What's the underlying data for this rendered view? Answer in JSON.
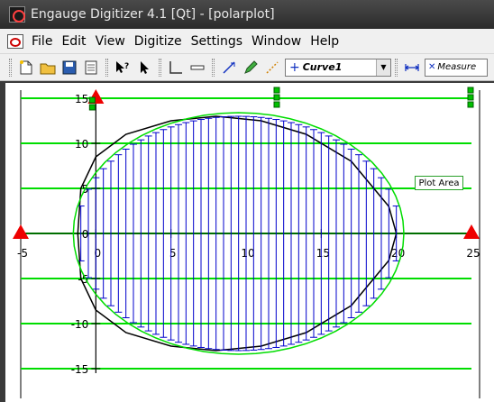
{
  "window": {
    "title": "Engauge Digitizer 4.1 [Qt] - [polarplot]"
  },
  "menu": [
    "File",
    "Edit",
    "View",
    "Digitize",
    "Settings",
    "Window",
    "Help"
  ],
  "toolbar": {
    "curve_name": "Curve1",
    "measure_name": "Measure"
  },
  "plot": {
    "x_ticks": [
      "-5",
      "0",
      "5",
      "10",
      "15",
      "20",
      "25"
    ],
    "y_ticks": [
      "15",
      "10",
      "5",
      "0",
      "-5",
      "-10",
      "-15"
    ],
    "segment_label": "Plot Area",
    "colors": {
      "grid": "#00dd00",
      "curve": "#0000cc",
      "axis_point": "#ee0000",
      "outline": "#000000"
    }
  },
  "chart_data": {
    "type": "line",
    "title": "",
    "xlabel": "",
    "ylabel": "",
    "xlim": [
      -5,
      25
    ],
    "ylim": [
      -15,
      15
    ],
    "grid": true,
    "axis_points": [
      [
        -5,
        0
      ],
      [
        25,
        0
      ],
      [
        0,
        15
      ]
    ],
    "series": [
      {
        "x": [
          -1.2,
          -1.0,
          0.0,
          2.0,
          5.0,
          8.0,
          11.0,
          14.0,
          17.0,
          19.5,
          20.0,
          19.5,
          17.0,
          14.0,
          11.0,
          8.0,
          5.0,
          2.0,
          0.0,
          -1.0,
          -1.2
        ],
        "y": [
          0.0,
          5.0,
          8.5,
          11.0,
          12.5,
          13.0,
          12.5,
          11.0,
          8.0,
          3.0,
          0.0,
          -3.0,
          -8.0,
          -11.0,
          -12.5,
          -13.0,
          -12.5,
          -11.0,
          -8.5,
          -5.0,
          0.0
        ]
      }
    ]
  }
}
